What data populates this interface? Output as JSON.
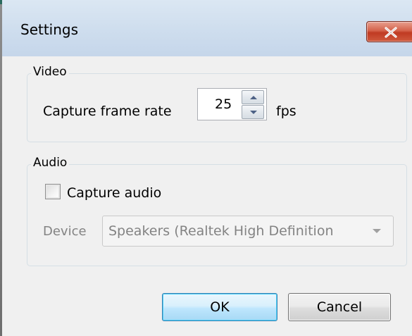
{
  "window": {
    "title": "Settings",
    "close_icon": "close-icon"
  },
  "video": {
    "group_label": "Video",
    "frame_rate_label": "Capture frame rate",
    "frame_rate_value": "25",
    "frame_rate_unit": "fps",
    "spin_up_icon": "triangle-up-icon",
    "spin_down_icon": "triangle-down-icon"
  },
  "audio": {
    "group_label": "Audio",
    "capture_audio_label": "Capture audio",
    "capture_audio_checked": false,
    "device_label": "Device",
    "device_value": "Speakers (Realtek High Definition",
    "device_enabled": false,
    "dropdown_icon": "chevron-down-icon"
  },
  "buttons": {
    "ok_label": "OK",
    "cancel_label": "Cancel"
  },
  "colors": {
    "close_button": "#c8402a",
    "ok_button_border": "#3c7fb1",
    "disabled_text": "#838383"
  }
}
